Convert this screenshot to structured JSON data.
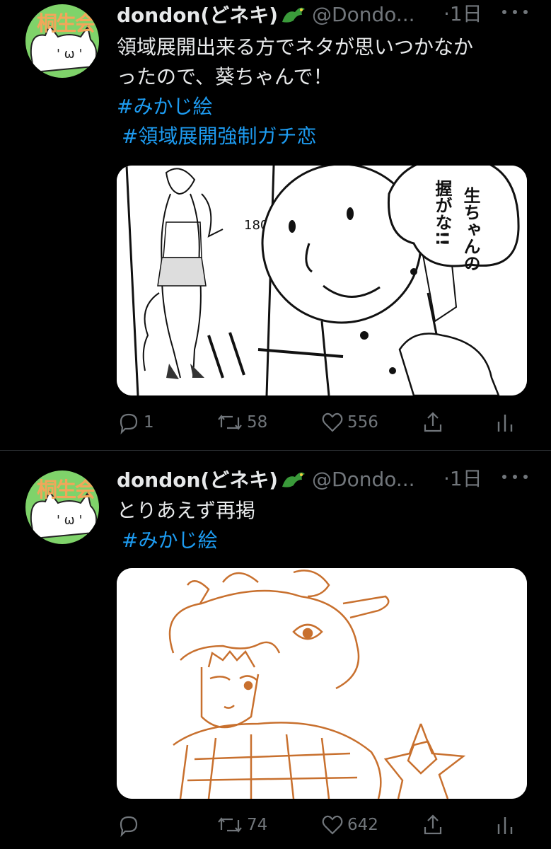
{
  "tweets": [
    {
      "author_name": "dondon(どネキ)",
      "handle": "@Dondo...",
      "time": "·1日",
      "avatar_text": "桐生会",
      "text_lines": [
        "領域展開出来る方でネタが思いつかなか",
        "ったので、葵ちゃんで！"
      ],
      "hashtags": [
        "#みかじ絵",
        "#領域展開強制ガチ恋"
      ],
      "media": {
        "bubble_text": [
          "生ちゃんの",
          "握がな!!"
        ],
        "height_mark": "180cm"
      },
      "actions": {
        "replies": "1",
        "retweets": "58",
        "likes": "556"
      }
    },
    {
      "author_name": "dondon(どネキ)",
      "handle": "@Dondo...",
      "time": "·1日",
      "avatar_text": "桐生会",
      "text_lines": [
        "とりあえず再掲"
      ],
      "hashtags": [
        "#みかじ絵"
      ],
      "actions": {
        "replies": "",
        "retweets": "74",
        "likes": "642"
      }
    }
  ],
  "icons": {
    "reply": "reply-icon",
    "retweet": "retweet-icon",
    "like": "heart-icon",
    "share": "share-icon",
    "analytics": "analytics-icon",
    "more": "more-icon",
    "verified_emoji": "dragon-icon"
  },
  "colors": {
    "background": "#000000",
    "link": "#1d9bf0",
    "muted": "#71767b",
    "sketch_orange": "#c8702e"
  }
}
